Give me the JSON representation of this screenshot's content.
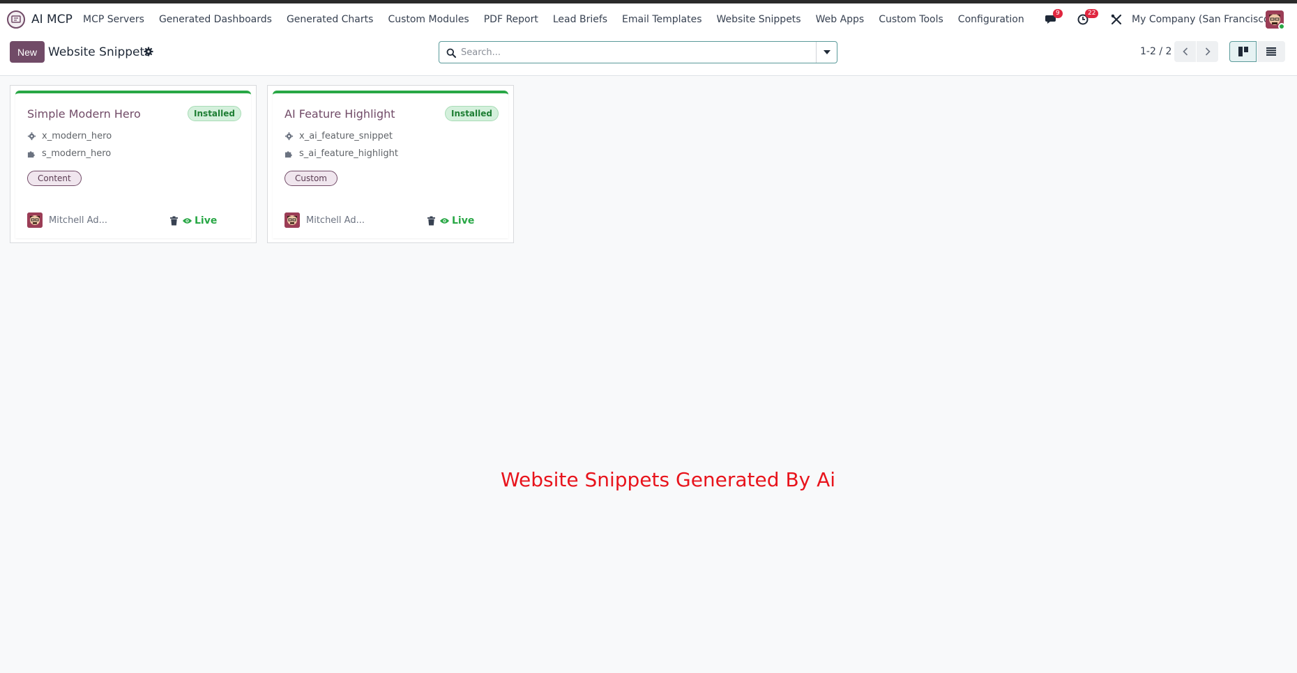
{
  "app": {
    "name": "AI MCP",
    "menu": [
      "MCP Servers",
      "Generated Dashboards",
      "Generated Charts",
      "Custom Modules",
      "PDF Report",
      "Lead Briefs",
      "Email Templates",
      "Website Snippets",
      "Web Apps",
      "Custom Tools",
      "Configuration"
    ]
  },
  "systray": {
    "messages_count": "9",
    "activities_count": "22",
    "company": "My Company (San Francisco)"
  },
  "control_panel": {
    "new_label": "New",
    "title": "Website Snippets",
    "search_placeholder": "Search...",
    "pager": "1-2 / 2"
  },
  "cards": [
    {
      "title": "Simple Modern Hero",
      "status": "Installed",
      "technical_name": "x_modern_hero",
      "snippet_key": "s_modern_hero",
      "tag": "Content",
      "author": "Mitchell Ad...",
      "live_label": "Live"
    },
    {
      "title": "AI Feature Highlight",
      "status": "Installed",
      "technical_name": "x_ai_feature_snippet",
      "snippet_key": "s_ai_feature_highlight",
      "tag": "Custom",
      "author": "Mitchell Ad...",
      "live_label": "Live"
    }
  ],
  "overlay": {
    "caption": "Website Snippets Generated By Ai"
  },
  "colors": {
    "brand": "#714b67",
    "success": "#28a745",
    "badge": "#e0263f",
    "caption": "#e8141c"
  },
  "icons": [
    "app-logo-icon",
    "chat-icon",
    "activity-clock-icon",
    "tools-icon",
    "gear-icon",
    "search-icon",
    "caret-down-icon",
    "chevron-left-icon",
    "chevron-right-icon",
    "kanban-view-icon",
    "list-view-icon",
    "puzzle-icon",
    "trash-icon",
    "eye-icon"
  ]
}
